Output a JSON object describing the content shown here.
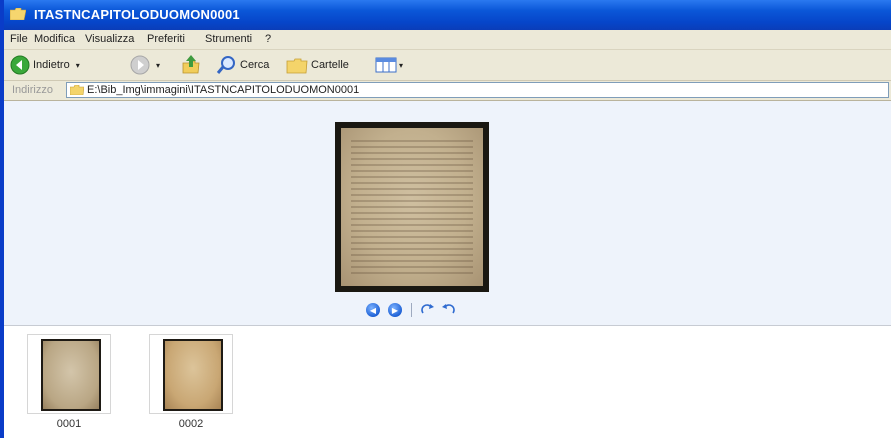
{
  "window": {
    "title": "ITASTNCAPITOLODUOMON0001"
  },
  "menu": [
    "File",
    "Modifica",
    "Visualizza",
    "Preferiti",
    "Strumenti",
    "?"
  ],
  "toolbar": {
    "back_label": "Indietro",
    "search_label": "Cerca",
    "folders_label": "Cartelle"
  },
  "address": {
    "label": "Indirizzo",
    "path": "E:\\Bib_Img\\immagini\\ITASTNCAPITOLODUOMON0001"
  },
  "thumbnails": [
    {
      "caption": "0001"
    },
    {
      "caption": "0002"
    }
  ],
  "colors": {
    "titlebar": "#0a52d6",
    "window_border": "#0a3cc8",
    "preview_bg": "#eef3fb",
    "chrome": "#ece9d8"
  }
}
